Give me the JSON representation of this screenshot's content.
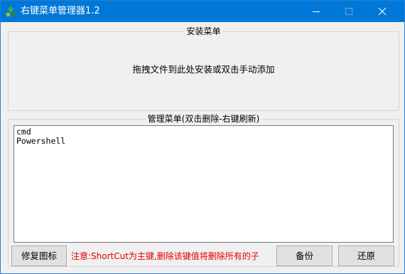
{
  "window": {
    "title": "右键菜单管理器1.2",
    "controls": {
      "minimize": "minimize-icon",
      "maximize": "maximize-icon",
      "close": "close-icon"
    }
  },
  "install_group": {
    "title": "安装菜单",
    "drop_hint": "拖拽文件到此处安装或双击手动添加"
  },
  "manage_group": {
    "title": "管理菜单(双击删除-右键刷新)",
    "items": [
      "cmd",
      "Powershell"
    ]
  },
  "footer": {
    "repair_icon_label": "修复图标",
    "notice": "注意:ShortCut为主键,删除该键值将删除所有的子",
    "backup_label": "备份",
    "restore_label": "还原"
  },
  "colors": {
    "titlebar": "#0078d7",
    "notice_text": "#e00000",
    "window_bg": "#f0f0f0"
  }
}
